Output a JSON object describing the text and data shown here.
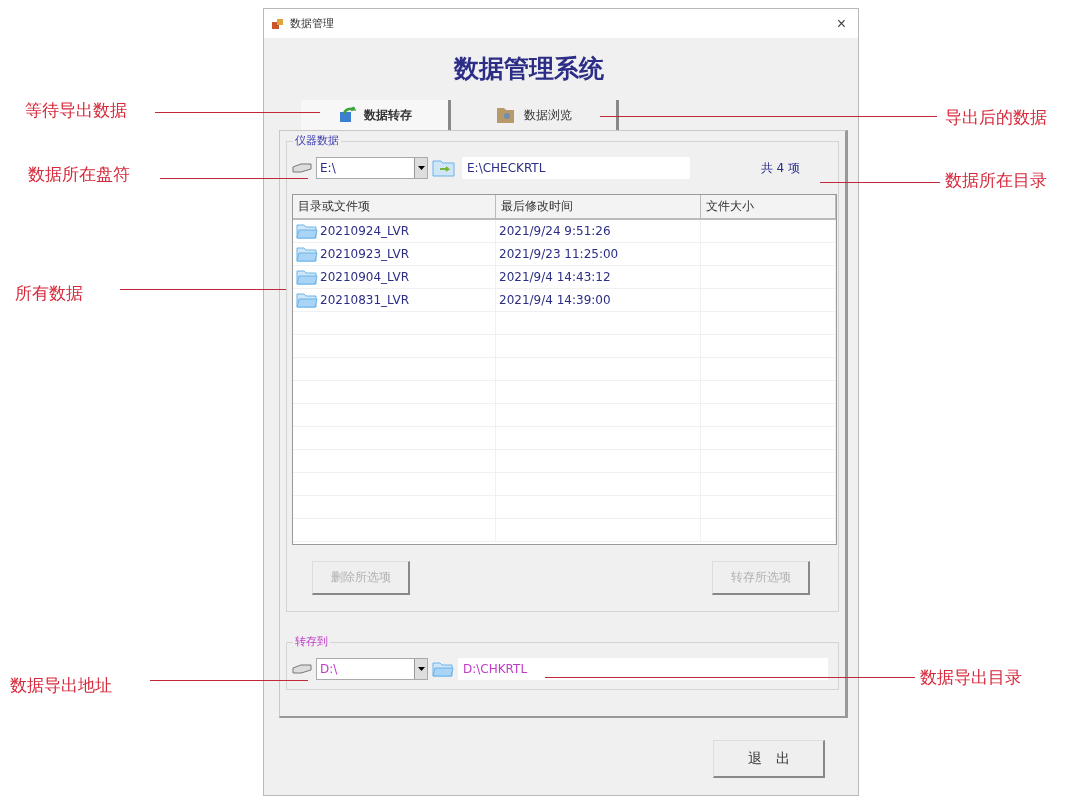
{
  "window": {
    "title": "数据管理",
    "close": "×"
  },
  "heading": "数据管理系统",
  "tabs": [
    {
      "label": "数据转存",
      "selected": true
    },
    {
      "label": "数据浏览",
      "selected": false
    }
  ],
  "source": {
    "legend": "仪器数据",
    "drive": "E:\\",
    "path": "E:\\CHECKRTL",
    "count": "共 4 项"
  },
  "table": {
    "columns": [
      "目录或文件项",
      "最后修改时间",
      "文件大小"
    ],
    "rows": [
      {
        "name": "20210924_LVR",
        "modified": "2021/9/24 9:51:26"
      },
      {
        "name": "20210923_LVR",
        "modified": "2021/9/23 11:25:00"
      },
      {
        "name": "20210904_LVR",
        "modified": "2021/9/4 14:43:12"
      },
      {
        "name": "20210831_LVR",
        "modified": "2021/9/4 14:39:00"
      }
    ]
  },
  "actions": [
    {
      "label": "删除所选项",
      "disabled": true
    },
    {
      "label": "转存所选项",
      "disabled": true
    }
  ],
  "target": {
    "legend": "转存到",
    "drive": "D:\\",
    "path": "D:\\CHKRTL"
  },
  "exit_button": {
    "label": "退　出",
    "disabled": false
  },
  "annotations": [
    {
      "text": "等待导出数据"
    },
    {
      "text": "数据所在盘符"
    },
    {
      "text": "所有数据"
    },
    {
      "text": "数据导出地址"
    },
    {
      "text": "导出后的数据"
    },
    {
      "text": "数据所在目录"
    },
    {
      "text": "数据导出目录"
    }
  ]
}
